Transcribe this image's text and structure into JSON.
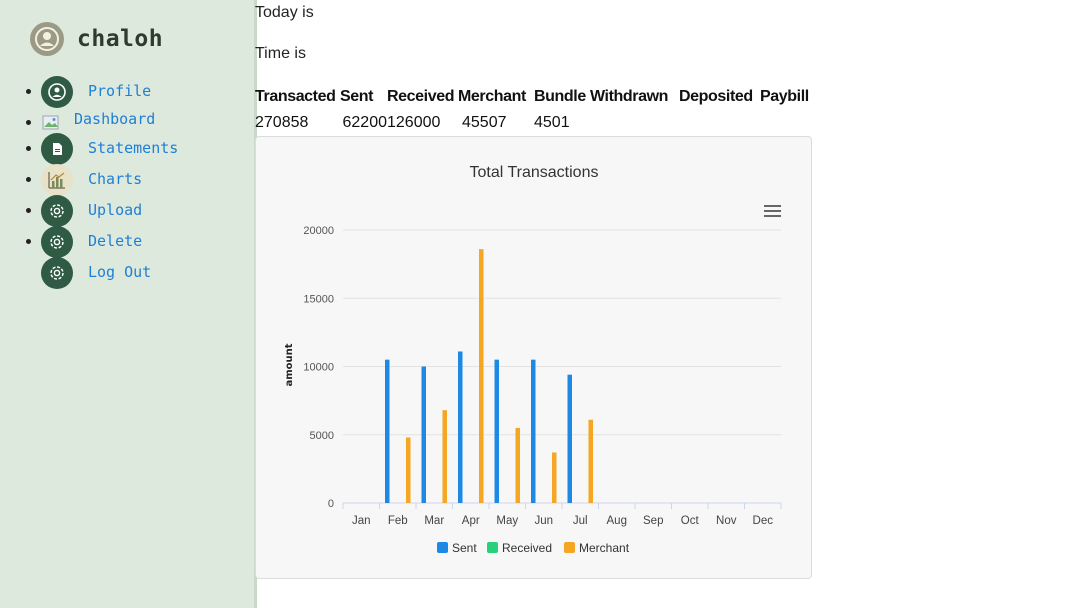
{
  "brand": {
    "name": "chaloh"
  },
  "nav": {
    "items": [
      {
        "label": "Profile",
        "icon": "user-circle-icon"
      },
      {
        "label": "Dashboard",
        "icon": "broken-image-icon"
      },
      {
        "label": "Statements",
        "icon": "document-icon"
      },
      {
        "label": "Charts",
        "icon": "chart-icon"
      },
      {
        "label": "Upload",
        "icon": "gear-icon"
      },
      {
        "label": "Delete",
        "icon": "gear-icon"
      },
      {
        "label": "Log Out",
        "icon": "gear-icon"
      }
    ]
  },
  "main": {
    "today_label": "Today is",
    "time_label": "Time is"
  },
  "stats": {
    "headers": [
      "Transacted",
      "Sent",
      "Received",
      "Merchant",
      "Bundle",
      "Withdrawn",
      "Deposited",
      "Paybill"
    ],
    "values": [
      "270858",
      "62200",
      "126000",
      "45507",
      "4501",
      "",
      "",
      ""
    ]
  },
  "chart_data": {
    "type": "bar",
    "title": "Total Transactions",
    "ylabel": "amount",
    "xlabel": "",
    "categories": [
      "Jan",
      "Feb",
      "Mar",
      "Apr",
      "May",
      "Jun",
      "Jul",
      "Aug",
      "Sep",
      "Oct",
      "Nov",
      "Dec"
    ],
    "series": [
      {
        "name": "Sent",
        "color": "#1e88e5",
        "values": [
          null,
          10500,
          10000,
          11100,
          10500,
          10500,
          9400,
          null,
          null,
          null,
          null,
          null
        ]
      },
      {
        "name": "Received",
        "color": "#26d07c",
        "values": [
          null,
          null,
          null,
          null,
          null,
          null,
          null,
          null,
          null,
          null,
          null,
          null
        ]
      },
      {
        "name": "Merchant",
        "color": "#f5a623",
        "values": [
          null,
          4800,
          6800,
          18600,
          5500,
          3700,
          6100,
          null,
          null,
          null,
          null,
          null
        ]
      }
    ],
    "yticks": [
      "0",
      "5000",
      "10000",
      "15000",
      "20000"
    ],
    "ylim": [
      0,
      20000
    ],
    "grid": true,
    "legend": "bottom"
  },
  "colors": {
    "sidebar_bg": "#dde9dc",
    "nav_icon_bg": "#2f5a43",
    "link": "#1f7fd6"
  }
}
